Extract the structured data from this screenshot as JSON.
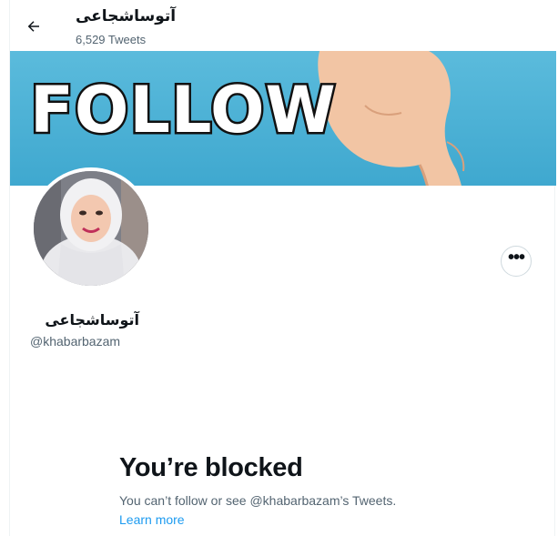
{
  "header": {
    "title": "آتوساشجاعی",
    "tweet_count": "6,529 Tweets",
    "back_icon": "arrow-left-icon"
  },
  "banner": {
    "text": "FOLLOW",
    "colors": {
      "sky": "#4fb3d6",
      "text": "#ffffff",
      "outline": "#111111"
    }
  },
  "profile": {
    "display_name": "آتوساشجاعی",
    "handle": "@khabarbazam",
    "more_icon": "more-horizontal-icon"
  },
  "blocked": {
    "title": "You’re blocked",
    "message": "You can’t follow or see @khabarbazam’s Tweets.",
    "learn_more": "Learn more"
  },
  "colors": {
    "text_primary": "#0f1419",
    "text_secondary": "#536471",
    "link": "#1d9bf0",
    "border": "#cfd9de"
  }
}
